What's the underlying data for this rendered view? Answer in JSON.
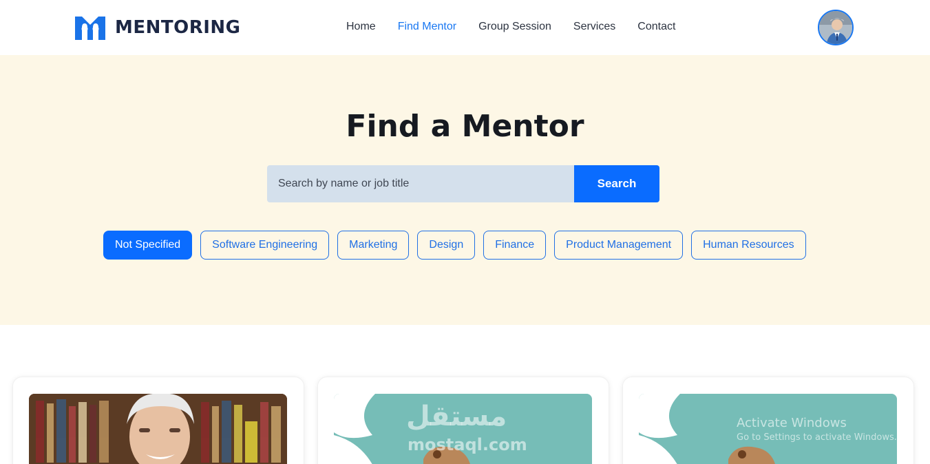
{
  "header": {
    "brand": "MENTORING",
    "brand_color": "#1c2744",
    "accent": "#1877f2",
    "nav": [
      {
        "label": "Home",
        "active": false
      },
      {
        "label": "Find Mentor",
        "active": true
      },
      {
        "label": "Group Session",
        "active": false
      },
      {
        "label": "Services",
        "active": false
      },
      {
        "label": "Contact",
        "active": false
      }
    ],
    "avatar_icon": "user-avatar"
  },
  "hero": {
    "title": "Find a Mentor",
    "background": "#fdf7e6",
    "search": {
      "placeholder": "Search by name or job title",
      "button_label": "Search"
    },
    "categories": [
      {
        "label": "Not Specified",
        "selected": true
      },
      {
        "label": "Software Engineering",
        "selected": false
      },
      {
        "label": "Marketing",
        "selected": false
      },
      {
        "label": "Design",
        "selected": false
      },
      {
        "label": "Finance",
        "selected": false
      },
      {
        "label": "Product Management",
        "selected": false
      },
      {
        "label": "Human Resources",
        "selected": false
      }
    ]
  },
  "watermark": {
    "arabic": "مستقل",
    "site": "mostaql.com",
    "activate_title": "Activate Windows",
    "activate_sub": "Go to Settings to activate Windows."
  }
}
